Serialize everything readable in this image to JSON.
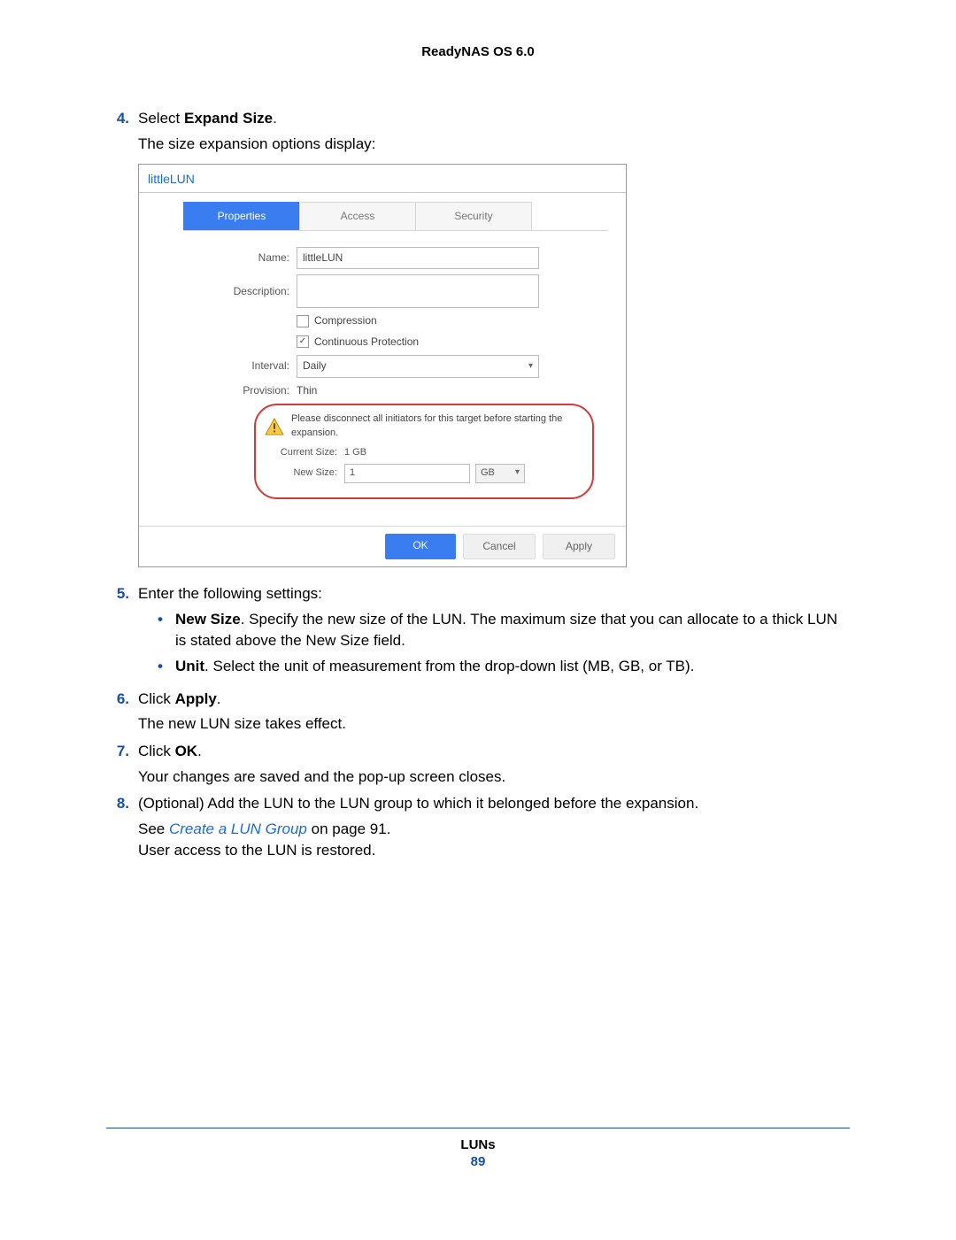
{
  "header": {
    "product": "ReadyNAS OS 6.0"
  },
  "steps": {
    "s4": {
      "num": "4.",
      "lead_pre": "Select ",
      "lead_bold": "Expand Size",
      "lead_post": ".",
      "desc": "The size expansion options display:"
    },
    "s5": {
      "num": "5.",
      "lead": "Enter the following settings:",
      "b1_bold": "New Size",
      "b1_text": ". Specify the new size of the LUN. The maximum size that you can allocate to a thick LUN is stated above the New Size field.",
      "b2_bold": "Unit",
      "b2_text": ". Select the unit of measurement from the drop-down list (MB, GB, or TB)."
    },
    "s6": {
      "num": "6.",
      "lead_pre": "Click ",
      "lead_bold": "Apply",
      "lead_post": ".",
      "desc": "The new LUN size takes effect."
    },
    "s7": {
      "num": "7.",
      "lead_pre": "Click ",
      "lead_bold": "OK",
      "lead_post": ".",
      "desc": "Your changes are saved and the pop-up screen closes."
    },
    "s8": {
      "num": "8.",
      "lead": "(Optional) Add the LUN to the LUN group to which it belonged before the expansion.",
      "see_pre": "See ",
      "see_link": "Create a LUN Group",
      "see_post": " on page 91.",
      "desc2": "User access to the LUN is restored."
    }
  },
  "screenshot": {
    "title": "littleLUN",
    "tabs": {
      "properties": "Properties",
      "access": "Access",
      "security": "Security"
    },
    "labels": {
      "name": "Name:",
      "description": "Description:",
      "compression": "Compression",
      "continuous": "Continuous Protection",
      "interval": "Interval:",
      "provision": "Provision:",
      "current_size": "Current Size:",
      "new_size": "New Size:"
    },
    "values": {
      "name": "littleLUN",
      "interval": "Daily",
      "provision": "Thin",
      "current_size": "1 GB",
      "new_size": "1",
      "unit": "GB"
    },
    "warning": "Please disconnect all initiators for this target before starting the expansion.",
    "buttons": {
      "ok": "OK",
      "cancel": "Cancel",
      "apply": "Apply"
    }
  },
  "footer": {
    "section": "LUNs",
    "page": "89"
  }
}
